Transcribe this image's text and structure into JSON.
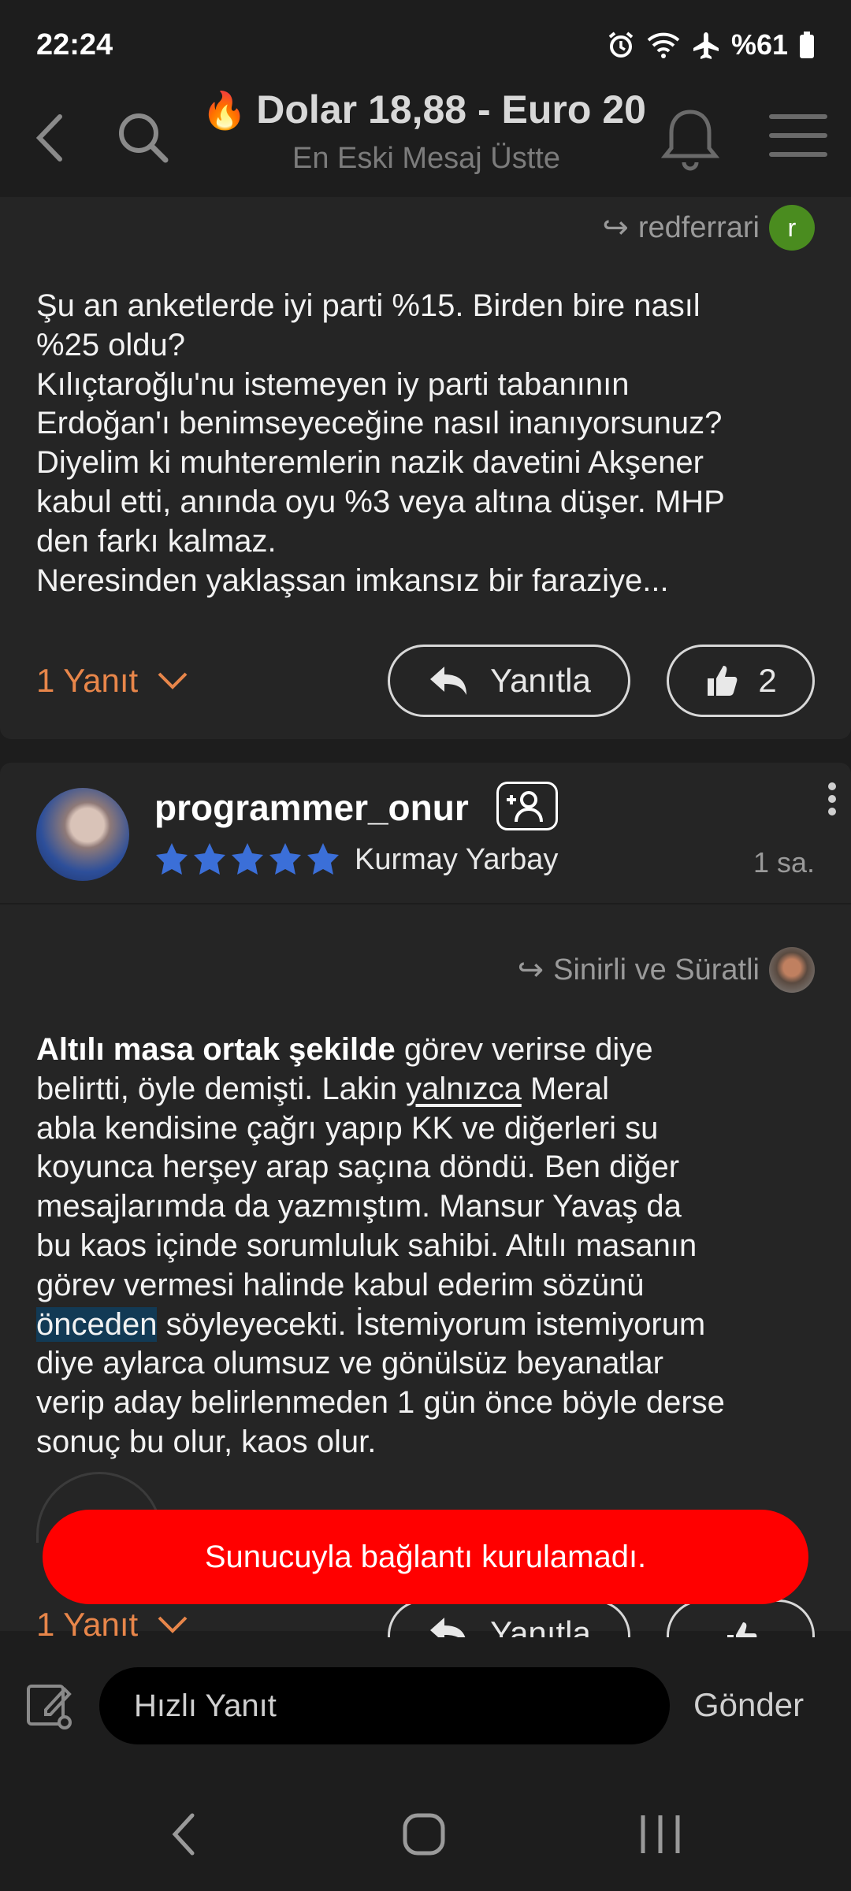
{
  "status_bar": {
    "time": "22:24",
    "battery": "%61",
    "icons": [
      "alarm-icon",
      "wifi-icon",
      "airplane-icon",
      "battery-icon"
    ]
  },
  "header": {
    "title_emoji": "🔥",
    "title": "Dolar 18,88 - Euro 20",
    "subtitle": "En Eski Mesaj Üstte"
  },
  "post1": {
    "quoted_user": "redferrari",
    "quoted_avatar_letter": "r",
    "text_lines": [
      "Şu an anketlerde iyi parti %15. Birden bire nasıl",
      "%25 oldu?",
      "Kılıçtaroğlu'nu istemeyen iy parti tabanının",
      "Erdoğan'ı benimseyeceğine nasıl inanıyorsunuz?",
      "Diyelim ki muhteremlerin nazik davetini Akşener",
      "kabul etti, anında oyu %3 veya altına düşer. MHP",
      "den farkı kalmaz.",
      "Neresinden yaklaşsan imkansız bir faraziye..."
    ],
    "replies_label": "1 Yanıt",
    "reply_button": "Yanıtla",
    "like_count": "2"
  },
  "post2": {
    "username": "programmer_onur",
    "rank": "Kurmay Yarbay",
    "star_count": 5,
    "time_ago": "1 sa.",
    "quoted_user": "Sinirli ve Süratli",
    "text": {
      "l1_bold": "Altılı masa ortak şekilde",
      "l1_rest": " görev verirse diye",
      "l2a": "belirtti, öyle demişti. Lakin ",
      "l2_underline": "yalnızca",
      "l2b": " Meral",
      "l3": "abla kendisine çağrı yapıp KK ve diğerleri su",
      "l4": "koyunca herşey arap saçına döndü. Ben diğer",
      "l5": "mesajlarımda da yazmıştım. Mansur Yavaş da",
      "l6": "bu kaos içinde sorumluluk sahibi. Altılı masanın",
      "l7": "görev vermesi halinde kabul ederim sözünü",
      "l8_highlight": "önceden",
      "l8_rest": " söyleyecekti. İstemiyorum istemiyorum",
      "l9": "diye aylarca olumsuz ve gönülsüz beyanatlar",
      "l10": "verip aday belirlenmeden 1 gün önce böyle derse",
      "l11": "sonuç bu olur, kaos olur."
    },
    "replies_label": "1 Yanıt",
    "reply_button": "Yanıtla"
  },
  "toast": {
    "message": "Sunucuyla bağlantı kurulamadı."
  },
  "composer": {
    "placeholder": "Hızlı Yanıt",
    "send_label": "Gönder"
  },
  "colors": {
    "background": "#1d1d1d",
    "card": "#252525",
    "accent_orange": "#e8864a",
    "toast_red": "#ff0000",
    "star_blue": "#3b6fd8",
    "avatar_green": "#4a8c1f"
  }
}
